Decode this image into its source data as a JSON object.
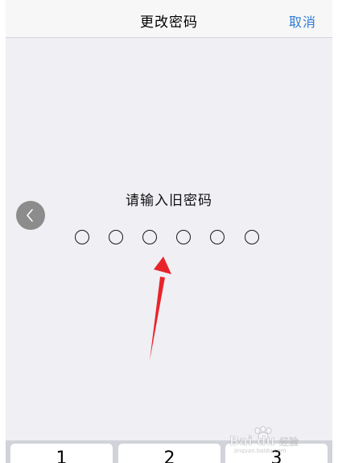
{
  "header": {
    "title": "更改密码",
    "cancel_label": "取消"
  },
  "main": {
    "prompt": "请输入旧密码",
    "passcode_length": 6,
    "back_icon": "chevron-left-icon"
  },
  "keypad": {
    "keys": [
      "1",
      "2",
      "3"
    ]
  },
  "watermark": {
    "brand_text": "Bai du 经验",
    "sub_text": "jingyan.baidu.com"
  },
  "colors": {
    "accent": "#2f7bd6",
    "annotation_arrow": "#e8242b"
  }
}
